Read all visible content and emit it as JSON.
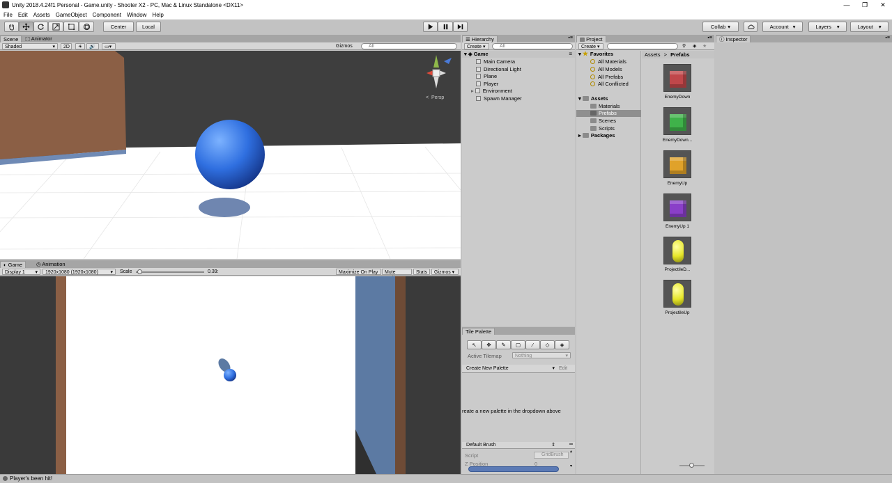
{
  "window": {
    "title": "Unity 2018.4.24f1 Personal - Game.unity - Shooter X2 - PC, Mac & Linux Standalone <DX11>"
  },
  "menu": [
    "File",
    "Edit",
    "Assets",
    "GameObject",
    "Component",
    "Window",
    "Help"
  ],
  "toolbar": {
    "pivot": "Center",
    "space": "Local",
    "collab": "Collab",
    "account": "Account",
    "layers": "Layers",
    "layout": "Layout"
  },
  "scene": {
    "tabs": [
      "Scene",
      "Animator"
    ],
    "shading": "Shaded",
    "mode2d": "2D",
    "gizmos": "Gizmos",
    "search_placeholder": "All",
    "persp": "Persp"
  },
  "game": {
    "tabs": [
      "Game",
      "Animation"
    ],
    "display": "Display 1",
    "resolution": "1920x1080 (1920x1080)",
    "scale_label": "Scale",
    "scale_value": "0.39:",
    "scale_fraction": 0.05,
    "buttons": [
      "Maximize On Play",
      "Mute Audio",
      "Stats",
      "Gizmos"
    ]
  },
  "hierarchy": {
    "tab": "Hierarchy",
    "create": "Create",
    "search_placeholder": "All",
    "scene_name": "Game",
    "items": [
      "Main Camera",
      "Directional Light",
      "Plane",
      "Player",
      "Environment",
      "Spawn Manager"
    ]
  },
  "project": {
    "tab": "Project",
    "create": "Create",
    "favorites_label": "Favorites",
    "favorites": [
      "All Materials",
      "All Models",
      "All Prefabs",
      "All Conflicted"
    ],
    "assets_label": "Assets",
    "folders": [
      "Materials",
      "Prefabs",
      "Scenes",
      "Scripts"
    ],
    "selected_folder": "Prefabs",
    "packages_label": "Packages",
    "breadcrumb_root": "Assets",
    "breadcrumb_sep": ">",
    "breadcrumb_current": "Prefabs",
    "assets": [
      {
        "name": "EnemyDown",
        "color": "#c0474a",
        "shape": "cube"
      },
      {
        "name": "EnemyDown...",
        "color": "#3fb24a",
        "shape": "cube"
      },
      {
        "name": "EnemyUp",
        "color": "#e0a22a",
        "shape": "cube"
      },
      {
        "name": "EnemyUp 1",
        "color": "#8a3fc8",
        "shape": "cube"
      },
      {
        "name": "ProjectileD...",
        "color": "#e6e629",
        "shape": "capsule"
      },
      {
        "name": "ProjectileUp",
        "color": "#e6e629",
        "shape": "capsule"
      }
    ]
  },
  "inspector": {
    "tab": "Inspector"
  },
  "tile_palette": {
    "tab": "Tile Palette",
    "active_tilemap_label": "Active Tilemap",
    "active_tilemap_value": "Nothing",
    "palette_dropdown": "Create New Palette",
    "edit": "Edit",
    "message": "reate a new palette in the dropdown above",
    "brush": "Default Brush",
    "script_label": "Script",
    "script_value": "GridBrush",
    "zpos_label": "Z Position",
    "zpos_value": "0"
  },
  "status": {
    "message": "Player's been hit!"
  },
  "colors": {
    "sphere": "#2f6fe0",
    "wall": "#8b5f45",
    "side_wall": "#5c7aa3",
    "sky": "#3e3e3e"
  }
}
